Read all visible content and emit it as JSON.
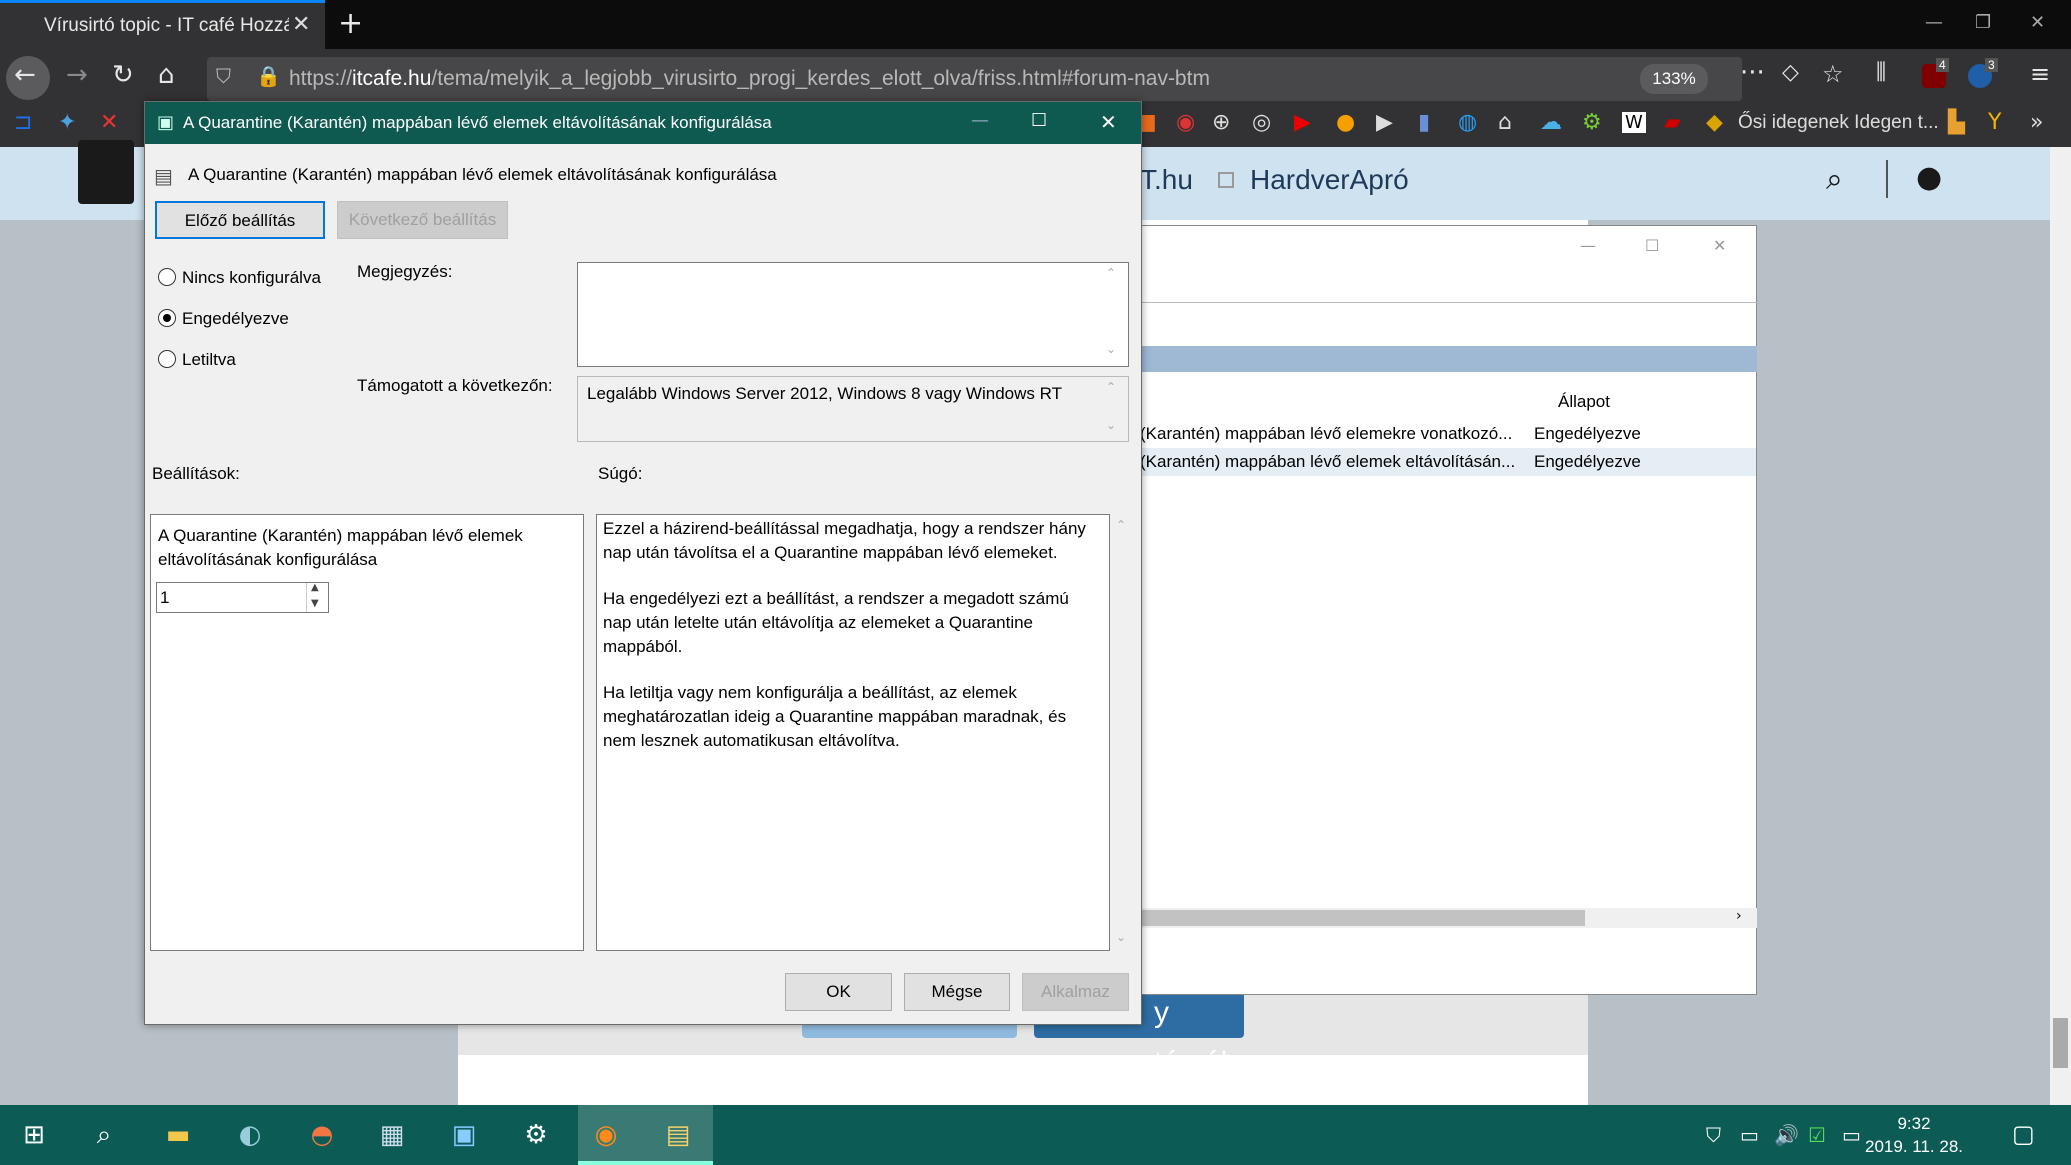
{
  "browser": {
    "tab_title": "Vírusirtó topic - IT café Hozzászólások",
    "new_tab": "+",
    "url_prefix": "https://",
    "url_domain": "itcafe.hu",
    "url_path": "/tema/melyik_a_legjobb_virusirto_progi_kerdes_elott_olva/friss.html#forum-nav-btm",
    "zoom": "133%",
    "badge_ublock": "4",
    "badge_ext": "3",
    "bookmark_text": "Ősi idegenek Idegen t..."
  },
  "site": {
    "nav_item1": "T.hu",
    "nav_item2": "HardverApró",
    "topics_button": "y témák"
  },
  "bg_window": {
    "col_state": "Állapot",
    "rows": [
      {
        "name": "(Karantén) mappában lévő elemekre vonatkozó...",
        "state": "Engedélyezve"
      },
      {
        "name": "(Karantén) mappában lévő elemek eltávolításán...",
        "state": "Engedélyezve"
      }
    ]
  },
  "dialog": {
    "title": "A Quarantine (Karantén) mappában lévő elemek eltávolításának konfigurálása",
    "heading": "A Quarantine (Karantén) mappában lévő elemek eltávolításának konfigurálása",
    "prev_button": "Előző beállítás",
    "next_button": "Következő beállítás",
    "radio_not_configured": "Nincs konfigurálva",
    "radio_enabled": "Engedélyezve",
    "radio_disabled": "Letiltva",
    "comment_label": "Megjegyzés:",
    "supported_label": "Támogatott a következőn:",
    "supported_value": "Legalább Windows Server 2012, Windows 8 vagy Windows RT",
    "options_label": "Beállítások:",
    "help_label": "Súgó:",
    "option_text": "A Quarantine (Karantén) mappában lévő elemek eltávolításának konfigurálása",
    "spin_value": "1",
    "help_p1": "Ezzel a házirend-beállítással megadhatja, hogy a rendszer hány nap után távolítsa el a Quarantine mappában lévő elemeket.",
    "help_p2": "Ha engedélyezi ezt a beállítást, a rendszer a megadott számú nap után letelte után eltávolítja az elemeket a Quarantine mappából.",
    "help_p3": "Ha letiltja vagy nem konfigurálja a beállítást, az elemek meghatározatlan ideig a Quarantine mappában maradnak, és nem lesznek automatikusan eltávolítva.",
    "ok_button": "OK",
    "cancel_button": "Mégse",
    "apply_button": "Alkalmaz"
  },
  "taskbar": {
    "time": "9:32",
    "date": "2019. 11. 28."
  }
}
